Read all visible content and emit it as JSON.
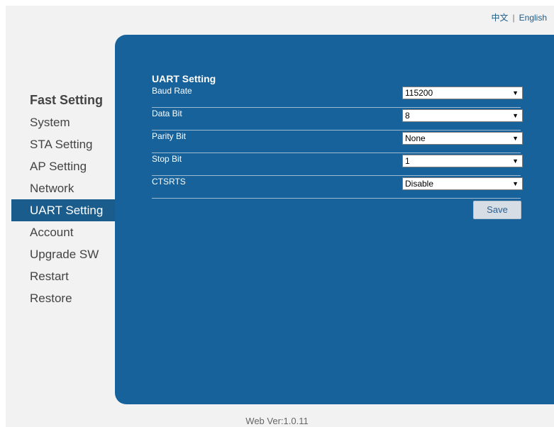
{
  "lang": {
    "chinese": "中文",
    "separator": "|",
    "english": "English"
  },
  "sidebar": {
    "heading": "Fast Setting",
    "items": [
      {
        "label": "System"
      },
      {
        "label": "STA Setting"
      },
      {
        "label": "AP Setting"
      },
      {
        "label": "Network"
      },
      {
        "label": "UART Setting",
        "active": true
      },
      {
        "label": "Account"
      },
      {
        "label": "Upgrade SW"
      },
      {
        "label": "Restart"
      },
      {
        "label": "Restore"
      }
    ]
  },
  "panel": {
    "title": "UART Setting",
    "fields": [
      {
        "label": "Baud Rate",
        "value": "115200"
      },
      {
        "label": "Data Bit",
        "value": "8"
      },
      {
        "label": "Parity Bit",
        "value": "None"
      },
      {
        "label": "Stop Bit",
        "value": "1"
      },
      {
        "label": "CTSRTS",
        "value": "Disable"
      }
    ],
    "save_label": "Save"
  },
  "footer": {
    "version": "Web Ver:1.0.11"
  },
  "colors": {
    "panel": "#17629a",
    "active_item": "#1a5c8c",
    "page_bg": "#f2f2f2"
  }
}
